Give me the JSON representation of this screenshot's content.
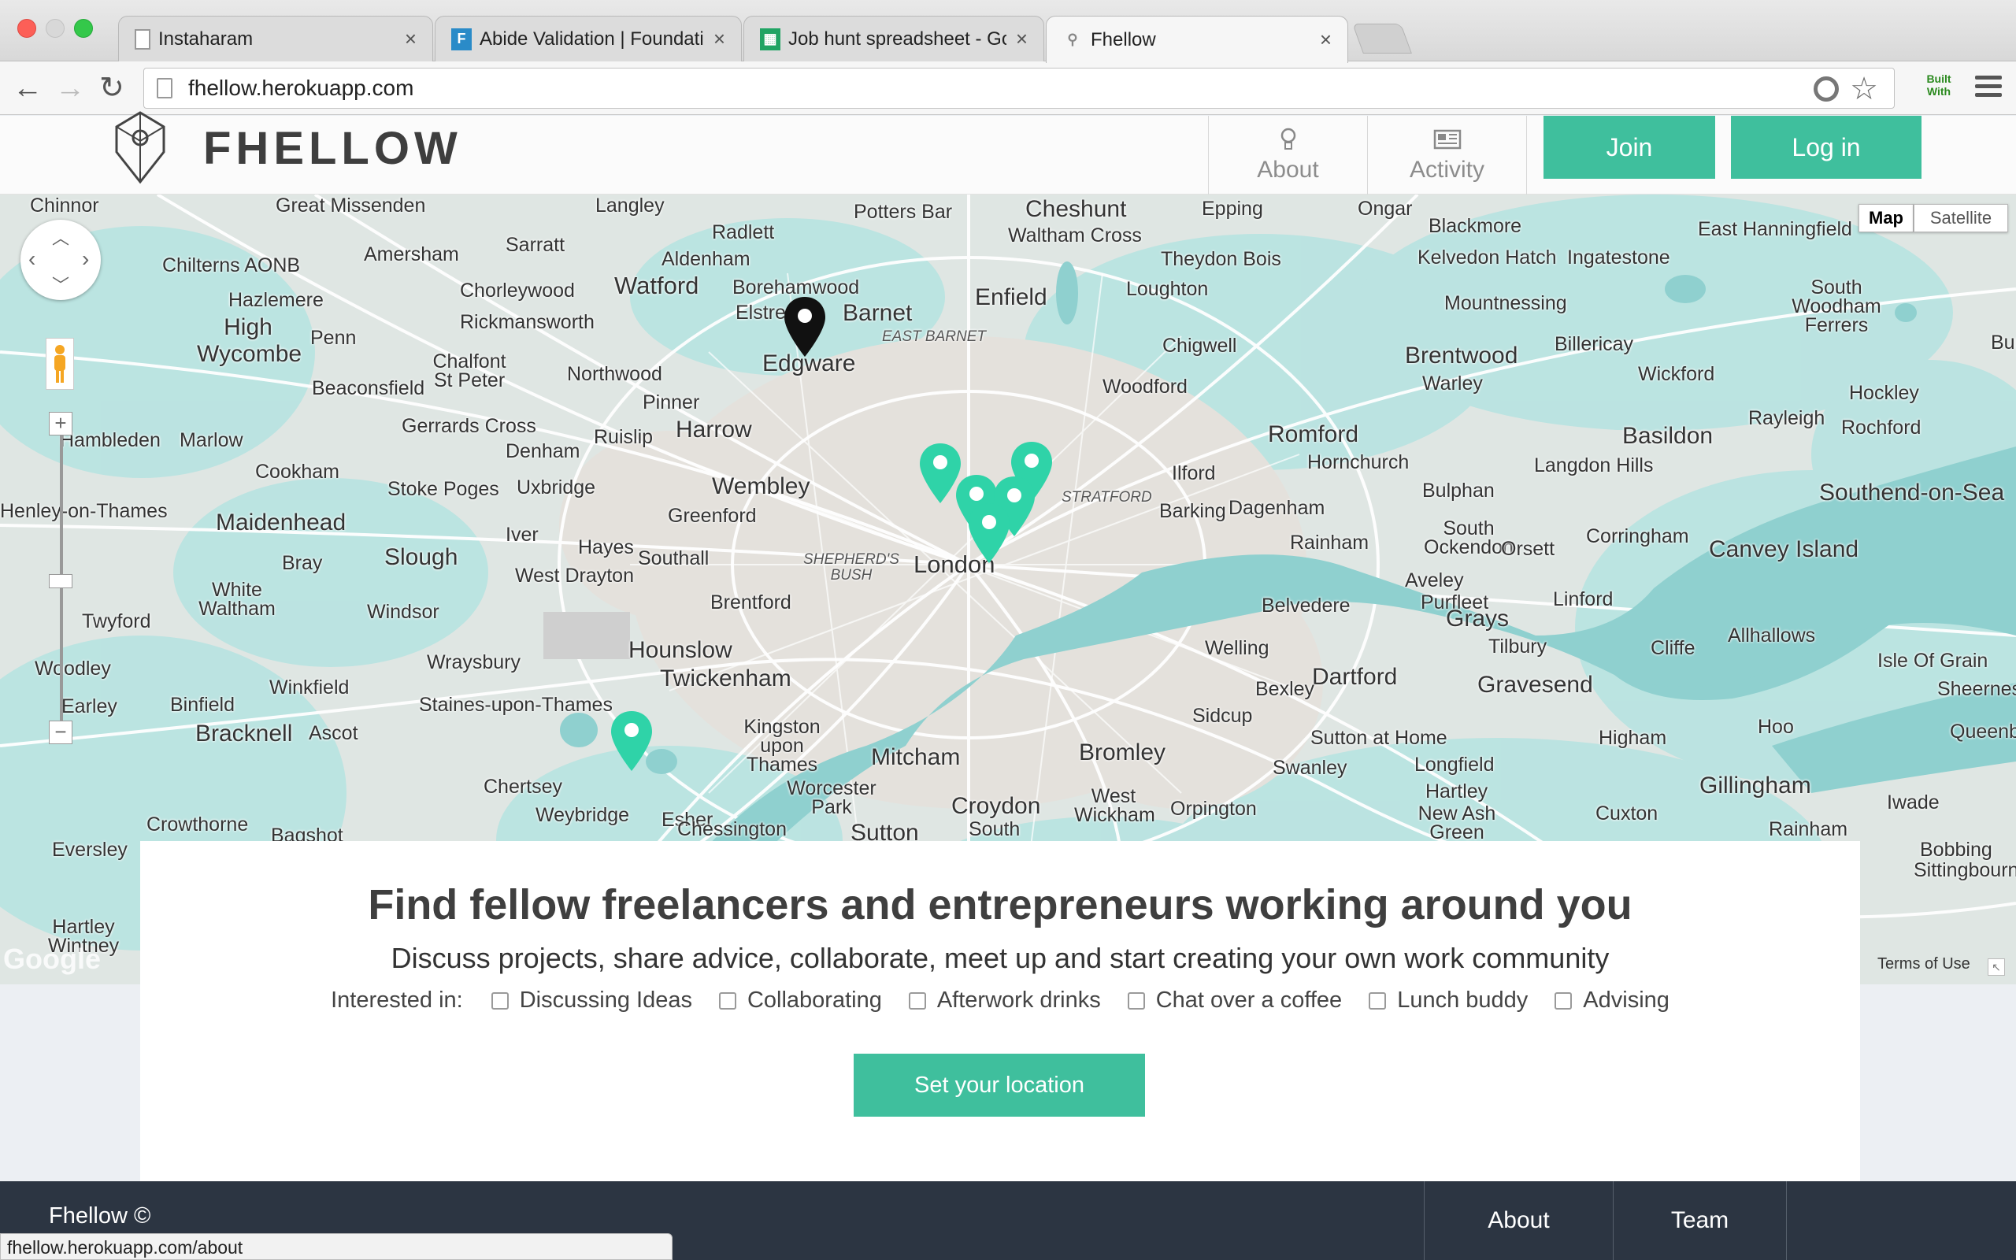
{
  "browser": {
    "tabs": [
      {
        "title": "Instaharam",
        "icon": "page-icon",
        "active": false
      },
      {
        "title": "Abide Validation | Foundati",
        "icon": "foundation-icon",
        "active": false
      },
      {
        "title": "Job hunt spreadsheet - Go",
        "icon": "sheets-icon",
        "active": false
      },
      {
        "title": "Fhellow",
        "icon": "pin-icon",
        "active": true
      }
    ],
    "url": "fhellow.herokuapp.com",
    "extension_label": "Built With",
    "status_url": "fhellow.herokuapp.com/about"
  },
  "header": {
    "logo": "FHELLOW",
    "nav": [
      {
        "label": "About",
        "icon": "lightbulb-icon"
      },
      {
        "label": "Activity",
        "icon": "newspaper-icon"
      }
    ],
    "join": "Join",
    "login": "Log in"
  },
  "map": {
    "type_controls": {
      "map": "Map",
      "satellite": "Satellite",
      "selected": "Map"
    },
    "attribution": "Google",
    "terms": "Terms of Use",
    "places": [
      "Chinnor",
      "Great Missenden",
      "Langley",
      "Potters Bar",
      "Cheshunt",
      "Epping",
      "Ongar",
      "Blackmore",
      "East Hanningfield",
      "Radlett",
      "Waltham Cross",
      "Theydon Bois",
      "Kelvedon Hatch",
      "Ingatestone",
      "Sarratt",
      "Aldenham",
      "Amersham",
      "Chilterns AONB",
      "Watford",
      "Borehamwood",
      "Chorleywood",
      "Elstree",
      "Barnet",
      "Enfield",
      "Loughton",
      "Mountnessing",
      "South Woodham Ferrers",
      "Hazlemere",
      "High Wycombe",
      "Penn",
      "Rickmansworth",
      "EAST BARNET",
      "Chigwell",
      "Brentwood",
      "Billericay",
      "Burnham",
      "Edgware",
      "Chalfont St Peter",
      "Northwood",
      "Woodford",
      "Warley",
      "Wickford",
      "Hockley",
      "Beaconsfield",
      "Pinner",
      "Rayleigh",
      "Gerrards Cross",
      "Harrow",
      "Rochford",
      "Hambleden",
      "Marlow",
      "Denham",
      "Ruislip",
      "Romford",
      "Basildon",
      "Hornchurch",
      "Langdon Hills",
      "Cookham",
      "Stoke Poges",
      "Uxbridge",
      "Wembley",
      "STRATFORD",
      "Ilford",
      "Bulphan",
      "Southend-on-Sea",
      "Henley-on-Thames",
      "Barking",
      "Dagenham",
      "Maidenhead",
      "Greenford",
      "Iver",
      "Hayes",
      "South Ockendon",
      "Corringham",
      "Slough",
      "Bray",
      "SHEPHERD'S BUSH",
      "London",
      "Rainham",
      "Aveley",
      "Orsett",
      "Canvey Island",
      "West Drayton",
      "Southall",
      "White Waltham",
      "Purfleet",
      "Linford",
      "Windsor",
      "Brentford",
      "Belvedere",
      "Grays",
      "Twyford",
      "Allhallows",
      "Tilbury",
      "Hounslow",
      "Cliffe",
      "Woodley",
      "Wraysbury",
      "Welling",
      "Isle Of Grain",
      "Twickenham",
      "Dartford",
      "Winkfield",
      "Bexley",
      "Gravesend",
      "Sheerness",
      "Earley",
      "Binfield",
      "Staines-upon-Thames",
      "Sidcup",
      "Kingston upon Thames",
      "Hoo",
      "Queenborough",
      "Bracknell",
      "Ascot",
      "Sutton at Home",
      "Higham",
      "Mitcham",
      "Bromley",
      "Longfield",
      "Chertsey",
      "Worcester Park",
      "Swanley",
      "Gillingham",
      "Hartley",
      "Iwade",
      "Croydon",
      "West Wickham",
      "Orpington",
      "Weybridge",
      "Esher",
      "Crowthorne",
      "New Ash Green",
      "Cuxton",
      "Chessington",
      "Sutton",
      "South",
      "Rainham",
      "Bagshot",
      "Eversley",
      "Bobbing",
      "Sittingbourne",
      "Hartley Wintney"
    ]
  },
  "hero": {
    "title": "Find fellow freelancers and entrepreneurs working around you",
    "subtitle": "Discuss projects, share advice, collaborate, meet up and start creating your own work community",
    "interested_label": "Interested in:",
    "interests": [
      "Discussing Ideas",
      "Collaborating",
      "Afterwork drinks",
      "Chat over a coffee",
      "Lunch buddy",
      "Advising"
    ],
    "cta": "Set your location"
  },
  "footer": {
    "copyright": "Fhellow ©",
    "links": [
      "About",
      "Team"
    ]
  },
  "colors": {
    "accent": "#3fbf9d",
    "footer_bg": "#2c3542",
    "map_water": "#8fd0cf",
    "map_land": "#dde5e3"
  }
}
